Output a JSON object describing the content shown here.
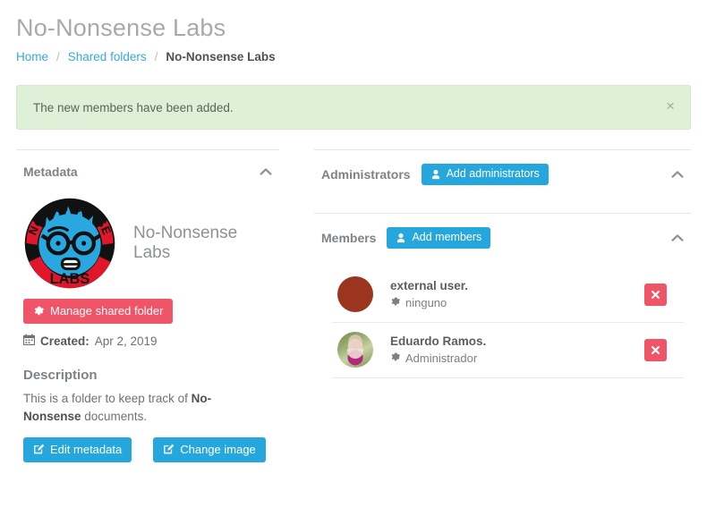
{
  "header": {
    "title": "No-Nonsense Labs",
    "breadcrumb": {
      "home": "Home",
      "shared_folders": "Shared folders",
      "current": "No-Nonsense Labs",
      "separator": "/"
    }
  },
  "alert": {
    "message": "The new members have been added.",
    "close_label": "×",
    "background": "#dff0d8",
    "text_color": "#56665a"
  },
  "metadata_panel": {
    "title": "Metadata",
    "collapse_icon": "chevron-up-icon",
    "folder_name": "No-Nonsense Labs",
    "logo": {
      "icon": "no-nonsense-labs-logo",
      "top_text": "NO-NONSENSE",
      "bottom_text": "LABS",
      "colors": {
        "ring_red": "#e2162a",
        "face_blue": "#29a8e0",
        "ink": "#111111"
      }
    },
    "manage_button": {
      "label": "Manage shared folder",
      "icon": "gear-icon",
      "color": "#ef5467"
    },
    "created": {
      "icon": "calendar-icon",
      "label": "Created:",
      "value": "Apr 2, 2019"
    },
    "description": {
      "heading": "Description",
      "text_before": "This is a folder to keep track of ",
      "text_bold": "No-Nonsense",
      "text_after": " documents."
    },
    "actions": [
      {
        "label": "Edit metadata",
        "icon": "edit-icon",
        "color": "#25a6dd"
      },
      {
        "label": "Change image",
        "icon": "edit-icon",
        "color": "#25a6dd"
      }
    ]
  },
  "administrators_panel": {
    "title": "Administrators",
    "add_button": {
      "label": "Add administrators",
      "icon": "user-icon",
      "color": "#25a6dd"
    },
    "collapse_icon": "chevron-up-icon",
    "members": []
  },
  "members_panel": {
    "title": "Members",
    "add_button": {
      "label": "Add members",
      "icon": "user-icon",
      "color": "#25a6dd"
    },
    "collapse_icon": "chevron-up-icon",
    "members": [
      {
        "name": "external user.",
        "role": "ninguno",
        "role_icon": "gear-icon",
        "avatar": "plain-maroon-circle",
        "remove_label": "✖"
      },
      {
        "name": "Eduardo Ramos.",
        "role": "Administrador",
        "role_icon": "gear-icon",
        "avatar": "photo-portrait",
        "remove_label": "✖"
      }
    ]
  }
}
